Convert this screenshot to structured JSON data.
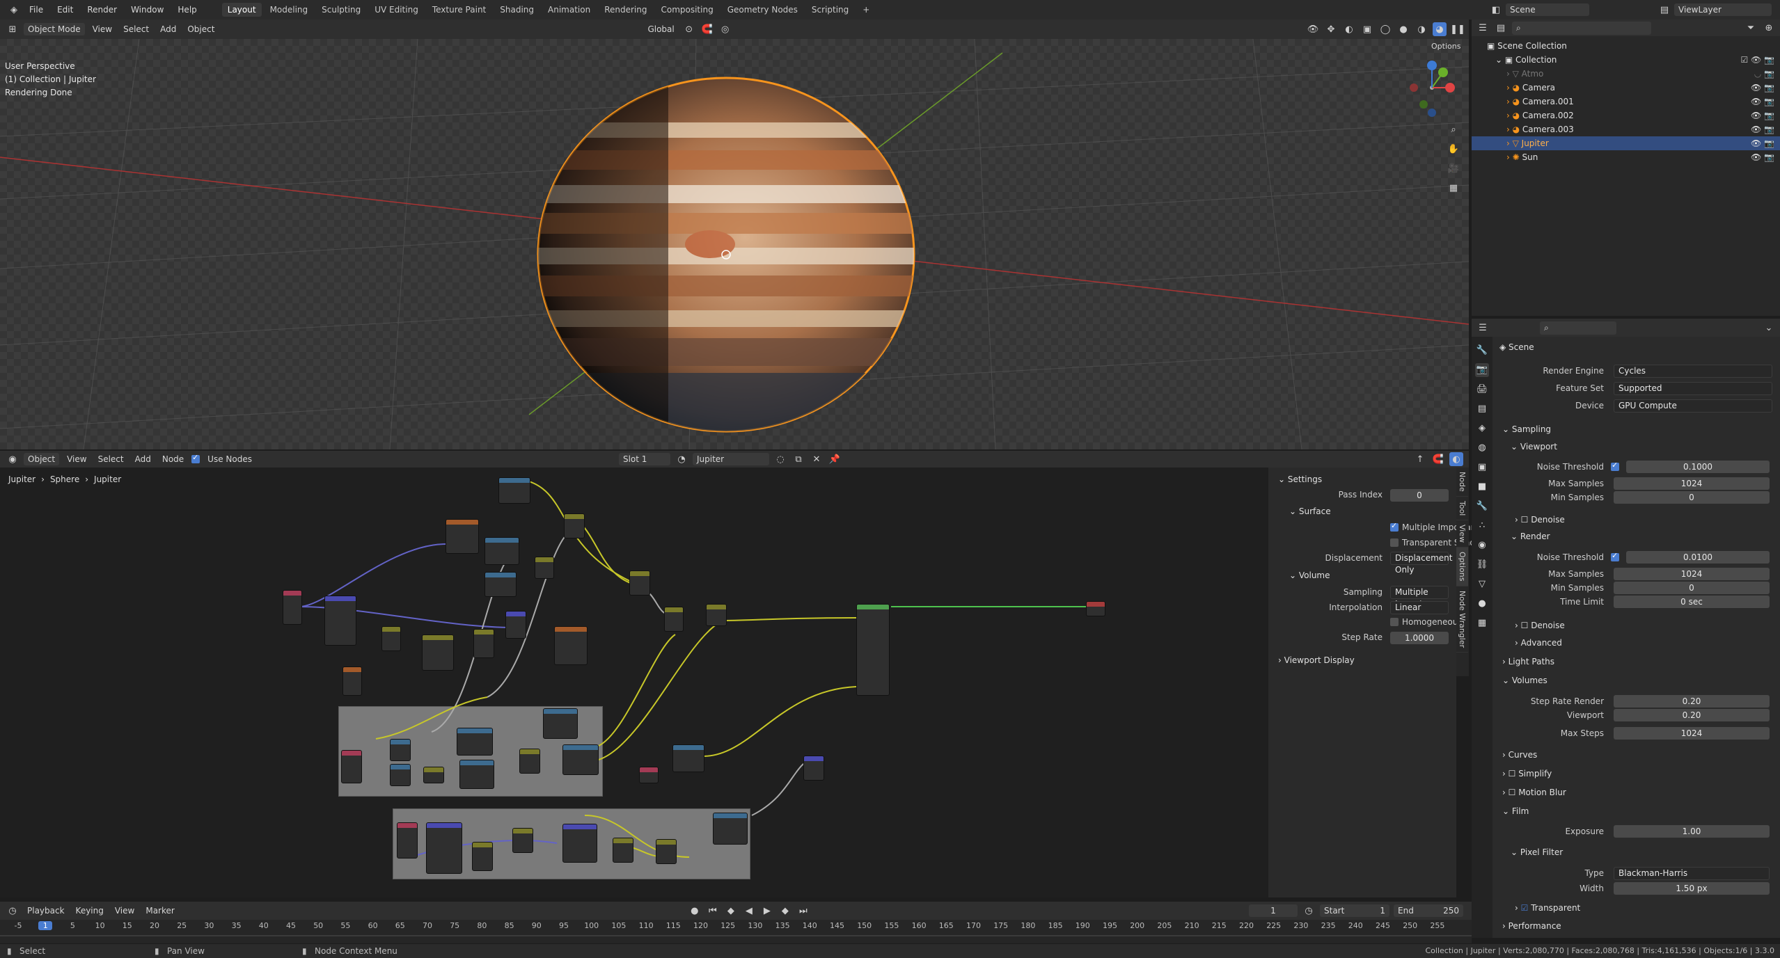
{
  "topbar": {
    "menus": [
      "File",
      "Edit",
      "Render",
      "Window",
      "Help"
    ],
    "workspaces": [
      "Layout",
      "Modeling",
      "Sculpting",
      "UV Editing",
      "Texture Paint",
      "Shading",
      "Animation",
      "Rendering",
      "Compositing",
      "Geometry Nodes",
      "Scripting"
    ],
    "active_workspace": "Layout",
    "scene": "Scene",
    "view_layer": "ViewLayer"
  },
  "viewport": {
    "mode": "Object Mode",
    "menus": [
      "View",
      "Select",
      "Add",
      "Object"
    ],
    "orientation": "Global",
    "options": "Options",
    "info": [
      "User Perspective",
      "(1) Collection | Jupiter",
      "Rendering Done"
    ]
  },
  "node_editor": {
    "type": "Object",
    "menus": [
      "View",
      "Select",
      "Add",
      "Node"
    ],
    "use_nodes": "Use Nodes",
    "slot": "Slot 1",
    "material": "Jupiter",
    "breadcrumb": [
      "Jupiter",
      "Sphere",
      "Jupiter"
    ]
  },
  "node_panel": {
    "settings": "Settings",
    "pass_index_label": "Pass Index",
    "pass_index": "0",
    "surface": "Surface",
    "multiple_importance": "Multiple Importance",
    "transparent_shadows": "Transparent Shadows",
    "displacement_label": "Displacement",
    "displacement": "Displacement Only",
    "volume": "Volume",
    "sampling_label": "Sampling",
    "sampling": "Multiple Importance",
    "interpolation_label": "Interpolation",
    "interpolation": "Linear",
    "homogeneous": "Homogeneous",
    "step_rate_label": "Step Rate",
    "step_rate": "1.0000",
    "viewport_display": "Viewport Display",
    "tabs": [
      "Node",
      "Tool",
      "View",
      "Options",
      "Node Wrangler"
    ]
  },
  "outliner": {
    "root": "Scene Collection",
    "collection": "Collection",
    "items": [
      "Atmo",
      "Camera",
      "Camera.001",
      "Camera.002",
      "Camera.003",
      "Jupiter",
      "Sun"
    ],
    "selected": "Jupiter"
  },
  "properties": {
    "title": "Scene",
    "render_engine_label": "Render Engine",
    "render_engine": "Cycles",
    "feature_set_label": "Feature Set",
    "feature_set": "Supported",
    "device_label": "Device",
    "device": "GPU Compute",
    "sampling": "Sampling",
    "viewport": "Viewport",
    "noise_threshold_label": "Noise Threshold",
    "vp_noise": "0.1000",
    "max_samples_label": "Max Samples",
    "vp_max": "1024",
    "min_samples_label": "Min Samples",
    "vp_min": "0",
    "denoise": "Denoise",
    "render": "Render",
    "r_noise": "0.0100",
    "r_max": "1024",
    "r_min": "0",
    "time_limit_label": "Time Limit",
    "time_limit": "0 sec",
    "advanced": "Advanced",
    "light_paths": "Light Paths",
    "volumes": "Volumes",
    "step_rate_render_label": "Step Rate Render",
    "step_rate_render": "0.20",
    "viewport_label": "Viewport",
    "vol_viewport": "0.20",
    "max_steps_label": "Max Steps",
    "max_steps": "1024",
    "curves": "Curves",
    "simplify": "Simplify",
    "motion_blur": "Motion Blur",
    "film": "Film",
    "exposure_label": "Exposure",
    "exposure": "1.00",
    "pixel_filter": "Pixel Filter",
    "type_label": "Type",
    "filter_type": "Blackman-Harris",
    "width_label": "Width",
    "filter_width": "1.50 px",
    "transparent": "Transparent",
    "performance": "Performance"
  },
  "timeline": {
    "menus": [
      "Playback",
      "Keying",
      "View",
      "Marker"
    ],
    "current_frame": "1",
    "start_label": "Start",
    "start": "1",
    "end_label": "End",
    "end": "250",
    "ruler": [
      "-5",
      "1",
      "5",
      "10",
      "15",
      "20",
      "25",
      "30",
      "35",
      "40",
      "45",
      "50",
      "55",
      "60",
      "65",
      "70",
      "75",
      "80",
      "85",
      "90",
      "95",
      "100",
      "105",
      "110",
      "115",
      "120",
      "125",
      "130",
      "135",
      "140",
      "145",
      "150",
      "155",
      "160",
      "165",
      "170",
      "175",
      "180",
      "185",
      "190",
      "195",
      "200",
      "205",
      "210",
      "215",
      "220",
      "225",
      "230",
      "235",
      "240",
      "245",
      "250",
      "255"
    ]
  },
  "status": {
    "select": "Select",
    "pan": "Pan View",
    "context": "Node Context Menu",
    "stats": "Collection | Jupiter | Verts:2,080,770 | Faces:2,080,768 | Tris:4,161,536 | Objects:1/6 | 3.3.0"
  },
  "colors": {
    "accent": "#4a7dd1",
    "selection": "#f7941d",
    "active_row": "#334d80"
  }
}
